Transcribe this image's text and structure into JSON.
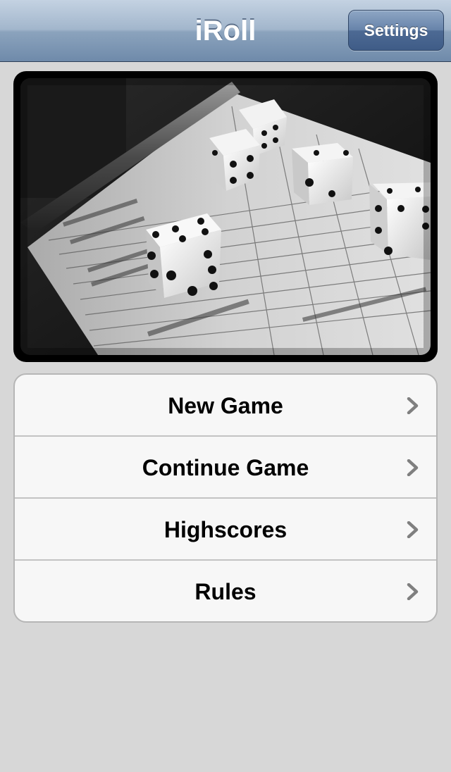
{
  "navbar": {
    "title": "iRoll",
    "settings_label": "Settings"
  },
  "photo": {
    "description_icon": "dice-on-scorecard-photo"
  },
  "menu": {
    "items": [
      {
        "label": "New Game",
        "icon": "chevron-right-icon"
      },
      {
        "label": "Continue Game",
        "icon": "chevron-right-icon"
      },
      {
        "label": "Highscores",
        "icon": "chevron-right-icon"
      },
      {
        "label": "Rules",
        "icon": "chevron-right-icon"
      }
    ]
  },
  "colors": {
    "background": "#d7d7d7",
    "navbar_top": "#c4d2e2",
    "navbar_bottom": "#6f8aaa",
    "button": "#4d6a94",
    "menu_background": "#f7f7f7",
    "chevron": "#7f7f7f"
  }
}
